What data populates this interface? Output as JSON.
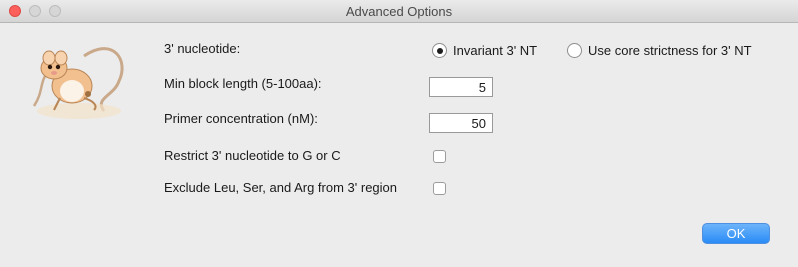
{
  "window": {
    "title": "Advanced Options"
  },
  "options": {
    "nucleotide_label": "3' nucleotide:",
    "radio_invariant": "Invariant 3' NT",
    "radio_core": "Use core strictness for 3' NT",
    "selected": "invariant",
    "min_block_label": "Min block length (5-100aa):",
    "min_block_value": "5",
    "primer_label": "Primer concentration (nM):",
    "primer_value": "50",
    "restrict_label": "Restrict 3' nucleotide to G or C",
    "restrict_checked": false,
    "exclude_label": "Exclude Leu, Ser, and Arg from 3' region",
    "exclude_checked": false
  },
  "buttons": {
    "ok": "OK"
  },
  "colors": {
    "accent": "#2a8cf6",
    "close": "#fc605c"
  },
  "icons": {
    "mascot": "kangaroo-rat-illustration"
  }
}
